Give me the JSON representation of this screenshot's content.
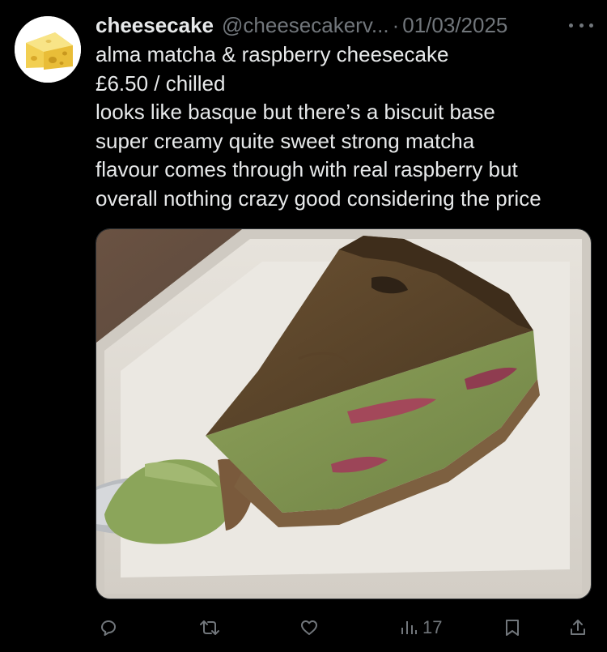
{
  "post": {
    "author": {
      "display_name": "cheesecake",
      "handle": "@cheesecakerv...",
      "avatar_icon": "cheese-wedge-icon"
    },
    "separator": "·",
    "date": "01/03/2025",
    "body_lines": [
      "alma matcha & raspberry cheesecake",
      "£6.50 / chilled",
      "looks like basque but there’s a biscuit base",
      "super creamy quite sweet strong matcha",
      "flavour comes through with real raspberry but",
      "overall nothing crazy good considering the price"
    ],
    "media": {
      "kind": "photo",
      "subject_icon": "cheesecake-slice-photo"
    },
    "actions": {
      "reply_icon": "reply-icon",
      "repost_icon": "repost-icon",
      "like_icon": "heart-icon",
      "views_icon": "views-icon",
      "views_count": "17",
      "bookmark_icon": "bookmark-icon",
      "share_icon": "share-icon"
    },
    "colors": {
      "background": "#000000",
      "primary_text": "#e7e9ea",
      "secondary_text": "#71767b"
    }
  }
}
